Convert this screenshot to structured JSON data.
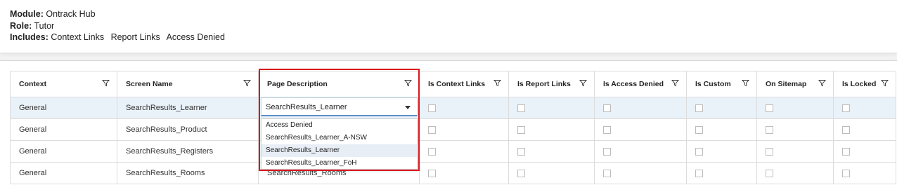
{
  "info": {
    "module_label": "Module:",
    "module_value": "Ontrack Hub",
    "role_label": "Role:",
    "role_value": "Tutor",
    "includes_label": "Includes:",
    "includes": [
      "Context Links",
      "Report Links",
      "Access Denied"
    ]
  },
  "grid": {
    "columns": [
      "Context",
      "Screen Name",
      "Page Description",
      "Is Context Links",
      "Is Report Links",
      "Is Access Denied",
      "Is Custom",
      "On Sitemap",
      "Is Locked"
    ],
    "rows": [
      {
        "context": "General",
        "screen_name": "SearchResults_Learner",
        "page_description": "SearchResults_Learner"
      },
      {
        "context": "General",
        "screen_name": "SearchResults_Product",
        "page_description": ""
      },
      {
        "context": "General",
        "screen_name": "SearchResults_Registers",
        "page_description": ""
      },
      {
        "context": "General",
        "screen_name": "SearchResults_Rooms",
        "page_description": "SearchResults_Rooms"
      }
    ]
  },
  "page_description_select": {
    "value": "SearchResults_Learner",
    "options": [
      "Access Denied",
      "SearchResults_Learner_A-NSW",
      "SearchResults_Learner",
      "SearchResults_Learner_FoH"
    ],
    "highlighted": "SearchResults_Learner"
  },
  "colors": {
    "highlight_border": "#d8161b",
    "selected_row": "#e9f1f9",
    "select_focus": "#5a8fc7"
  }
}
